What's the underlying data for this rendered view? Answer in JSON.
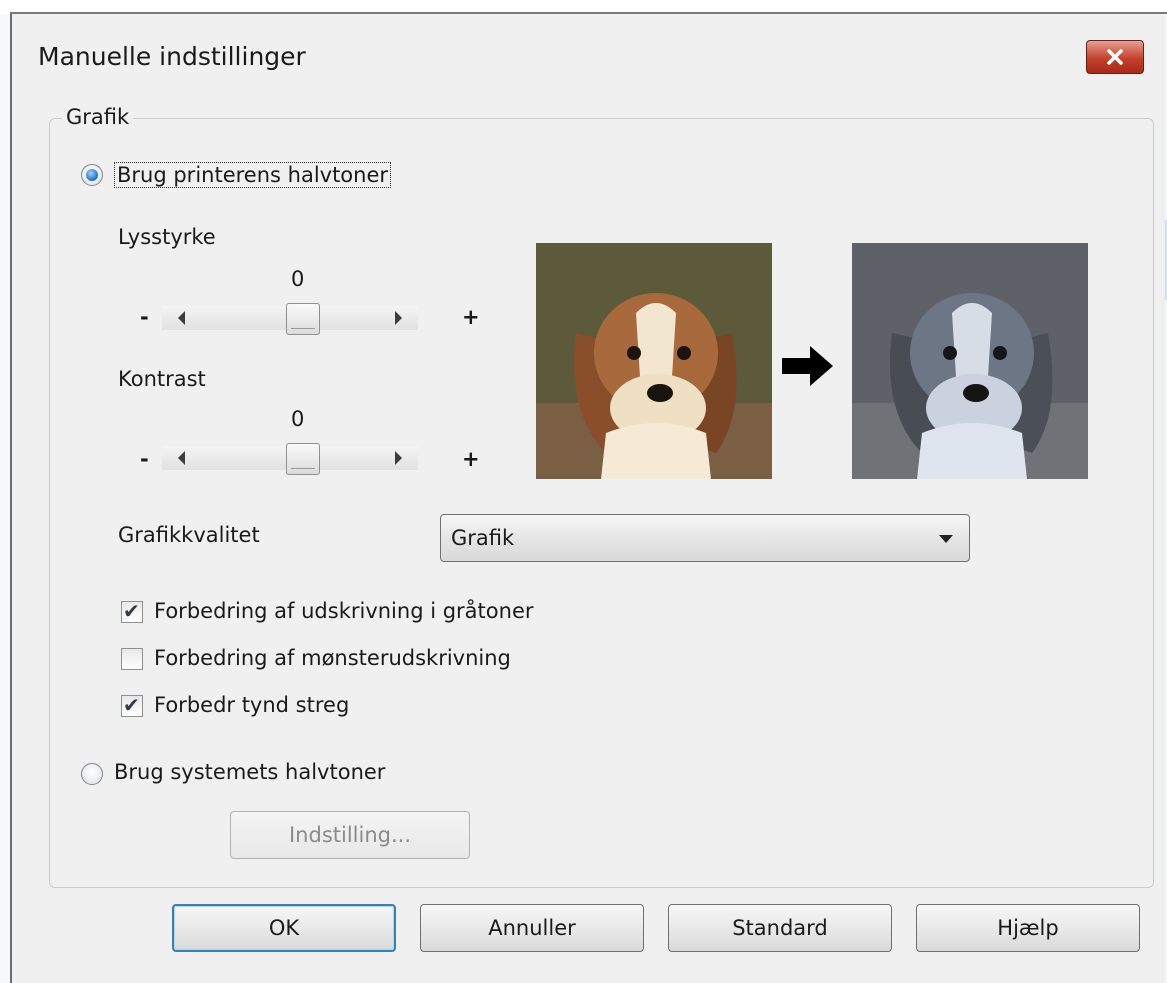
{
  "window": {
    "title": "Manuelle indstillinger"
  },
  "group": {
    "legend": "Grafik"
  },
  "options": {
    "printer_halftones": {
      "label": "Brug printerens halvtoner",
      "selected": true
    },
    "system_halftones": {
      "label": "Brug systemets halvtoner",
      "selected": false
    }
  },
  "brightness": {
    "label": "Lysstyrke",
    "value": "0",
    "minus": "-",
    "plus": "+"
  },
  "contrast": {
    "label": "Kontrast",
    "value": "0",
    "minus": "-",
    "plus": "+"
  },
  "graphics_quality": {
    "label": "Grafikkvalitet",
    "selected": "Grafik"
  },
  "checkboxes": [
    {
      "label": "Forbedring af udskrivning i gråtoner",
      "checked": true
    },
    {
      "label": "Forbedring af mønsterudskrivning",
      "checked": false
    },
    {
      "label": "Forbedr tynd streg",
      "checked": true
    }
  ],
  "settings_button": "Indstilling...",
  "buttons": {
    "ok": "OK",
    "cancel": "Annuller",
    "default": "Standard",
    "help": "Hjælp"
  },
  "icons": {
    "close": "close-icon",
    "arrow": "arrow-right-icon"
  }
}
